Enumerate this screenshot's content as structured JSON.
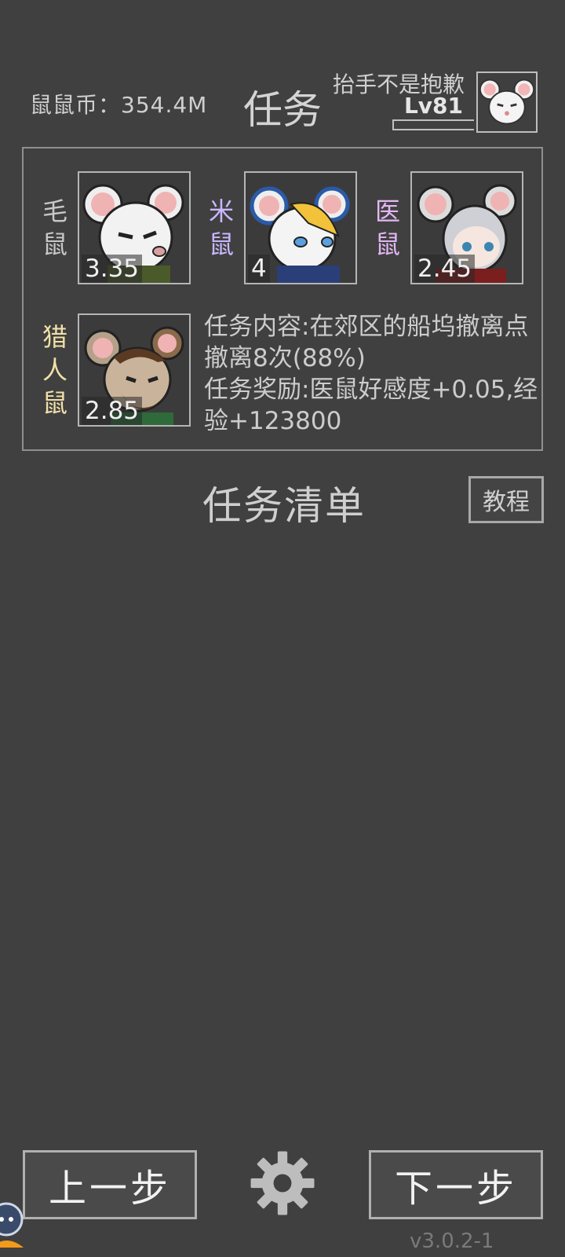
{
  "header": {
    "coins": "鼠鼠币：354.4M",
    "title": "任务",
    "username": "抬手不是抱歉",
    "level": "Lv81"
  },
  "characters": [
    {
      "name": "毛鼠",
      "score": "3.35",
      "name_color": "#c8c8c8"
    },
    {
      "name": "米鼠",
      "score": "4",
      "name_color": "#c9b8ff"
    },
    {
      "name": "医鼠",
      "score": "2.45",
      "name_color": "#e2b7f3"
    },
    {
      "name": "猎人鼠",
      "score": "2.85",
      "name_color": "#f1e0a8"
    }
  ],
  "task": {
    "content": "任务内容:在郊区的船坞撤离点撤离8次(88%)",
    "reward": "任务奖励:医鼠好感度+0.05,经验+123800"
  },
  "list": {
    "title": "任务清单",
    "tutorial": "教程"
  },
  "footer": {
    "prev": "上一步",
    "next": "下一步",
    "version": "v3.0.2-1"
  }
}
